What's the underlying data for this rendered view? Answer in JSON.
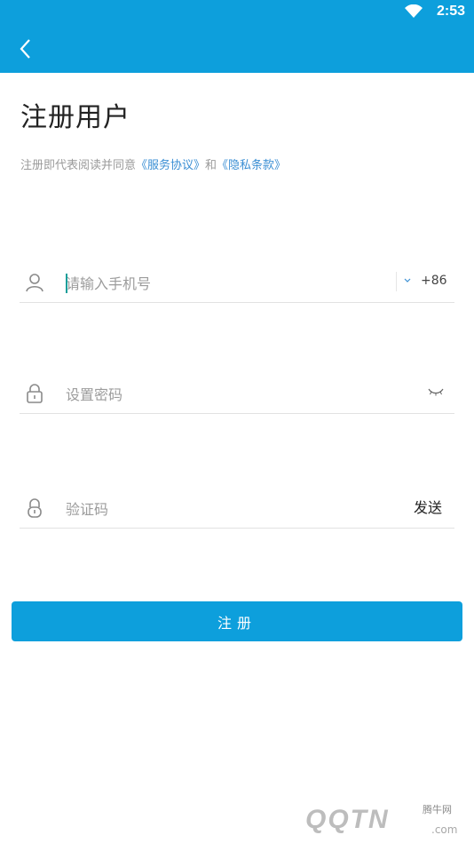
{
  "status_bar": {
    "time": "2:53",
    "wifi_icon": "wifi-icon"
  },
  "app_bar": {
    "back_icon": "chevron-left-icon",
    "color": "#0d9fdc"
  },
  "page": {
    "title": "注册用户",
    "agreement": {
      "prefix": "注册即代表阅读并同意",
      "terms_link": "《服务协议》",
      "conjunction": "和",
      "privacy_link": "《隐私条款》"
    }
  },
  "form": {
    "phone": {
      "placeholder": "请输入手机号",
      "country_code": "+86",
      "icon": "user-icon"
    },
    "password": {
      "placeholder": "设置密码",
      "icon": "lock-icon",
      "toggle_icon": "eye-closed-icon"
    },
    "verify": {
      "placeholder": "验证码",
      "send_label": "发送",
      "icon": "lock-icon"
    },
    "submit_label": "注册"
  },
  "watermark": {
    "site": "腾牛网",
    "brand": "QQTN",
    "domain": ".com"
  },
  "colors": {
    "primary": "#0d9fdc",
    "link": "#3b8fd4"
  }
}
